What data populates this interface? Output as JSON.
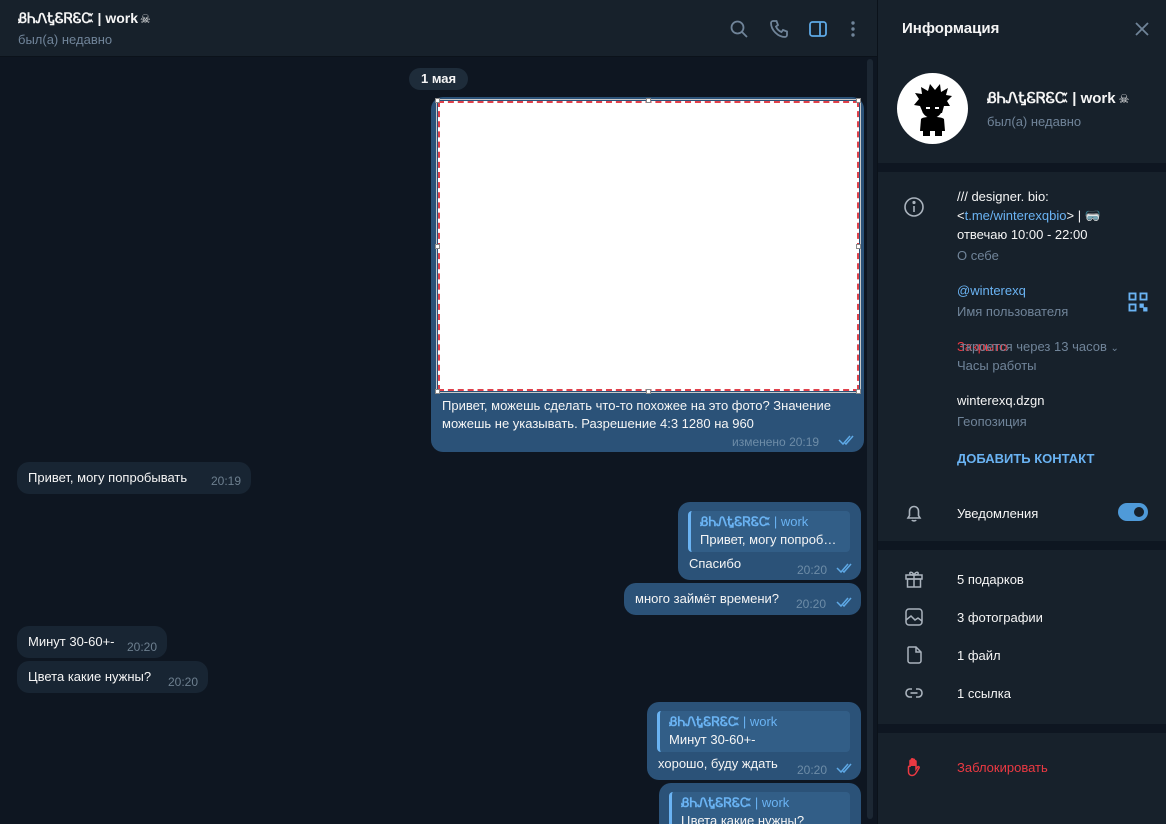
{
  "header": {
    "title": "ᏰᏂᏁᎿᏋᏒᏋᏨ | work",
    "status": "был(а) недавно"
  },
  "chat": {
    "date_label": "1 мая",
    "messages": [
      {
        "text_line1": "Привет, можешь сделать что-то похожее на это фото? Значение",
        "text_line2": "можешь не указывать. Разрешение 4:3 1280 на 960",
        "time": "изменено 20:19"
      },
      {
        "text": "Привет, могу попробывать",
        "time": "20:19"
      },
      {
        "reply_name": "ᏰᏂᏁᎿᏋᏒᏋᏨ",
        "reply_name_suffix": " | work",
        "reply_text": "Привет, могу попроб…",
        "text": "Спасибо",
        "time": "20:20"
      },
      {
        "text": "много займёт времени?",
        "time": "20:20"
      },
      {
        "text": "Минут 30-60+-",
        "time": "20:20"
      },
      {
        "text": "Цвета какие нужны?",
        "time": "20:20"
      },
      {
        "reply_name": "ᏰᏂᏁᎿᏋᏒᏋᏨ",
        "reply_name_suffix": " | work",
        "reply_text": "Минут 30-60+-",
        "text": "хорошо, буду ждать",
        "time": "20:20"
      },
      {
        "reply_name": "ᏰᏂᏁᎿᏋᏒᏋᏨ",
        "reply_name_suffix": " | work",
        "reply_text": "Цвета какие нужны?"
      }
    ]
  },
  "info": {
    "title": "Информация",
    "name": "ᏰᏂᏁᎿᏋᏒᏋᏨ | work",
    "status": "был(а) недавно",
    "bio_line1": "/// designer. bio:",
    "bio_prefix": "<",
    "bio_link": "t.me/winterexqbio",
    "bio_suffix": "> | 🥽",
    "bio_line3": "отвечаю 10:00 - 22:00",
    "bio_label": "О себе",
    "username": "@winterexq",
    "username_label": "Имя пользователя",
    "hours_status": "Закрыто",
    "hours_detail": "ткроется через 13 часов",
    "hours_label": "Часы работы",
    "location": "winterexq.dzgn",
    "location_label": "Геопозиция",
    "add_contact": "ДОБАВИТЬ КОНТАКТ",
    "notifications": "Уведомления",
    "gifts": "5 подарков",
    "photos": "3 фотографии",
    "files": "1 файл",
    "links": "1 ссылка",
    "block": "Заблокировать"
  }
}
